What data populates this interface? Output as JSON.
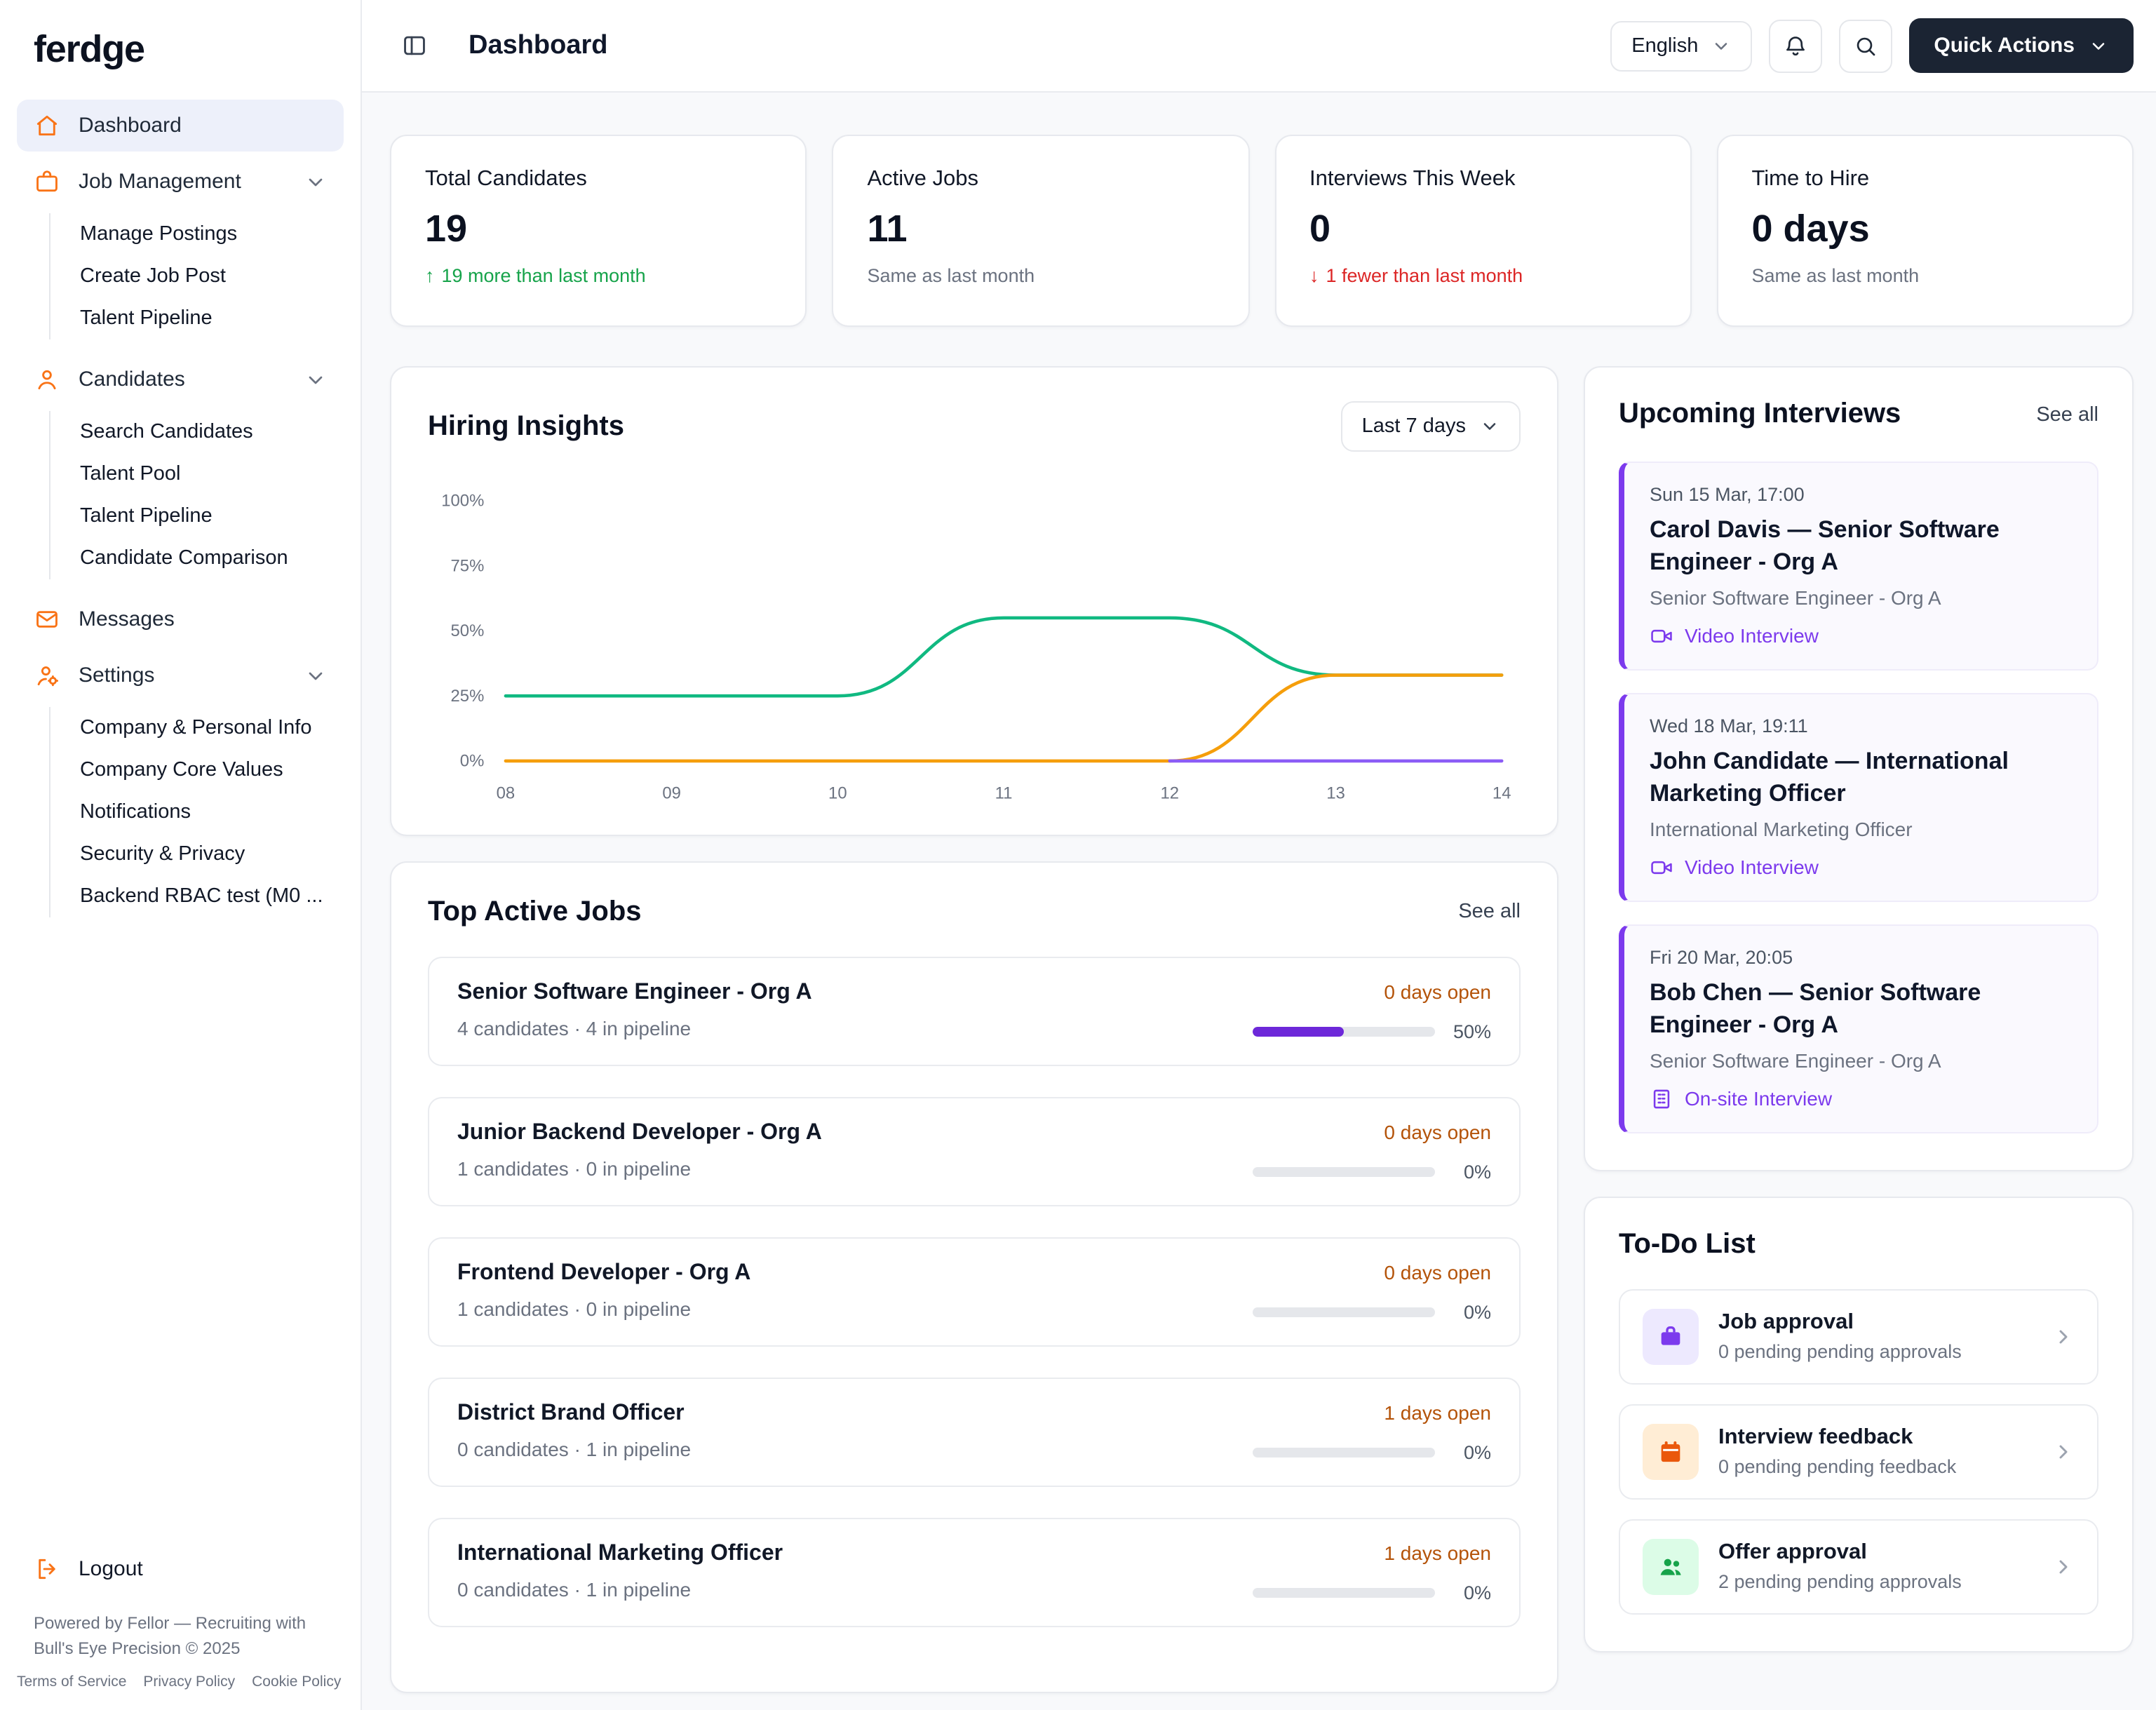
{
  "brand": {
    "logo_text": "ferdge"
  },
  "sidebar": {
    "items": [
      {
        "label": "Dashboard",
        "icon": "home-icon",
        "active": true
      },
      {
        "label": "Job Management",
        "icon": "briefcase-icon",
        "children": [
          {
            "label": "Manage Postings"
          },
          {
            "label": "Create Job Post"
          },
          {
            "label": "Talent Pipeline"
          }
        ]
      },
      {
        "label": "Candidates",
        "icon": "user-icon",
        "children": [
          {
            "label": "Search Candidates"
          },
          {
            "label": "Talent Pool"
          },
          {
            "label": "Talent Pipeline"
          },
          {
            "label": "Candidate Comparison"
          }
        ]
      },
      {
        "label": "Messages",
        "icon": "mail-icon"
      },
      {
        "label": "Settings",
        "icon": "user-settings-icon",
        "children": [
          {
            "label": "Company & Personal Info"
          },
          {
            "label": "Company Core Values"
          },
          {
            "label": "Notifications"
          },
          {
            "label": "Security & Privacy"
          },
          {
            "label": "Backend RBAC test (M0 ..."
          }
        ]
      }
    ],
    "logout_label": "Logout",
    "footer_text": "Powered by Fellor — Recruiting with Bull's Eye Precision © 2025",
    "footer_links": [
      "Terms of Service",
      "Privacy Policy",
      "Cookie Policy"
    ]
  },
  "header": {
    "title": "Dashboard",
    "language_selector": "English",
    "quick_actions_label": "Quick Actions"
  },
  "stats": [
    {
      "label": "Total Candidates",
      "value": "19",
      "delta": "19 more than last month",
      "trend": "up"
    },
    {
      "label": "Active Jobs",
      "value": "11",
      "delta": "Same as last month",
      "trend": "neutral"
    },
    {
      "label": "Interviews This Week",
      "value": "0",
      "delta": "1 fewer than last month",
      "trend": "down"
    },
    {
      "label": "Time to Hire",
      "value": "0 days",
      "delta": "Same as last month",
      "trend": "neutral"
    }
  ],
  "hiring_insights": {
    "title": "Hiring Insights",
    "range_label": "Last 7 days",
    "chart_data": {
      "type": "line",
      "x": [
        "08",
        "09",
        "10",
        "11",
        "12",
        "13",
        "14"
      ],
      "y_ticks": [
        "0%",
        "25%",
        "50%",
        "75%",
        "100%"
      ],
      "ylim": [
        0,
        100
      ],
      "grid": false,
      "legend": "none",
      "series": [
        {
          "name": "green-series",
          "color": "#10b981",
          "values": [
            25,
            25,
            25,
            55,
            55,
            33,
            33
          ]
        },
        {
          "name": "orange-series",
          "color": "#f59e0b",
          "values": [
            0,
            0,
            0,
            0,
            0,
            33,
            33
          ]
        },
        {
          "name": "purple-series",
          "color": "#8b5cf6",
          "values": [
            null,
            null,
            null,
            null,
            0,
            0,
            0
          ]
        }
      ]
    }
  },
  "top_active_jobs": {
    "title": "Top Active Jobs",
    "see_all": "See all",
    "jobs": [
      {
        "title": "Senior Software Engineer - Org A",
        "meta": "4 candidates · 4 in pipeline",
        "days_open": "0 days open",
        "percent": 50,
        "percent_label": "50%"
      },
      {
        "title": "Junior Backend Developer - Org A",
        "meta": "1 candidates · 0 in pipeline",
        "days_open": "0 days open",
        "percent": 0,
        "percent_label": "0%"
      },
      {
        "title": "Frontend Developer - Org A",
        "meta": "1 candidates · 0 in pipeline",
        "days_open": "0 days open",
        "percent": 0,
        "percent_label": "0%"
      },
      {
        "title": "District Brand Officer",
        "meta": "0 candidates · 1 in pipeline",
        "days_open": "1 days open",
        "percent": 0,
        "percent_label": "0%"
      },
      {
        "title": "International Marketing Officer",
        "meta": "0 candidates · 1 in pipeline",
        "days_open": "1 days open",
        "percent": 0,
        "percent_label": "0%"
      }
    ]
  },
  "upcoming_interviews": {
    "title": "Upcoming Interviews",
    "see_all": "See all",
    "items": [
      {
        "datetime": "Sun 15 Mar, 17:00",
        "title": "Carol Davis — Senior Software Engineer - Org A",
        "role": "Senior Software Engineer - Org A",
        "mode": "Video Interview",
        "mode_icon": "video-icon"
      },
      {
        "datetime": "Wed 18 Mar, 19:11",
        "title": "John Candidate — International Marketing Officer",
        "role": "International Marketing Officer",
        "mode": "Video Interview",
        "mode_icon": "video-icon"
      },
      {
        "datetime": "Fri 20 Mar, 20:05",
        "title": "Bob Chen — Senior Software Engineer - Org A",
        "role": "Senior Software Engineer - Org A",
        "mode": "On-site Interview",
        "mode_icon": "building-icon"
      }
    ]
  },
  "todo_list": {
    "title": "To-Do List",
    "items": [
      {
        "title": "Job approval",
        "subtitle": "0 pending pending approvals",
        "icon": "briefcase-icon",
        "accent": "#7c3aed"
      },
      {
        "title": "Interview feedback",
        "subtitle": "0 pending pending feedback",
        "icon": "calendar-icon",
        "accent": "#ea580c"
      },
      {
        "title": "Offer approval",
        "subtitle": "2 pending pending approvals",
        "icon": "users-icon",
        "accent": "#16a34a"
      }
    ]
  }
}
